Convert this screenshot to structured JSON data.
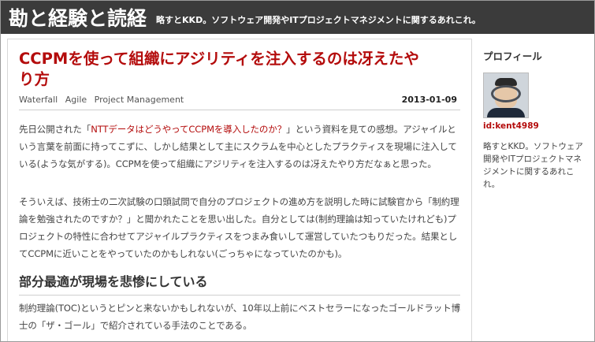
{
  "header": {
    "blog_title": "勘と経験と読経",
    "blog_description": "略すとKKD。ソフトウェア開発やITプロジェクトマネジメントに関するあれこれ。"
  },
  "entry": {
    "title": "CCPMを使って組織にアジリティを注入するのは冴えたやり方",
    "categories": [
      "Waterfall",
      "Agile",
      "Project Management"
    ],
    "date": "2013-01-09",
    "p1_before": "先日公開された「",
    "p1_link": "NTTデータはどうやってCCPMを導入したのか？",
    "p1_after": "」という資料を見ての感想。アジャイルという言葉を前面に持ってこずに、しかし結果として主にスクラムを中心としたプラクティスを現場に注入している(ような気がする)。CCPMを使って組織にアジリティを注入するのは冴えたやり方だなぁと思った。",
    "p2": "そういえば、技術士の二次試験の口頭試問で自分のプロジェクトの進め方を説明した時に試験官から「制約理論を勉強されたのですか？」と聞かれたことを思い出した。自分としては(制約理論は知っていたけれども)プロジェクトの特性に合わせてアジャイルプラクティスをつまみ食いして運営していたつもりだった。結果としてCCPMに近いことをやっていたのかもしれない(ごっちゃになっていたのかも)。",
    "heading": "部分最適が現場を悲惨にしている",
    "p3": "制約理論(TOC)というとピンと来ないかもしれないが、10年以上前にベストセラーになったゴールドラット博士の「ザ・ゴール」で紹介されている手法のことである。"
  },
  "sidebar": {
    "title": "プロフィール",
    "user_id": "id:kent4989",
    "description": "略すとKKD。ソフトウェア開発やITプロジェクトマネジメントに関するあれこれ。"
  },
  "colors": {
    "header_bg": "#3b3b3b",
    "accent": "#b40c0c"
  }
}
